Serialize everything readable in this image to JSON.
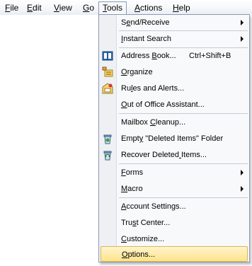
{
  "menubar": {
    "items": [
      {
        "label": "File",
        "accel": "F"
      },
      {
        "label": "Edit",
        "accel": "E"
      },
      {
        "label": "View",
        "accel": "V"
      },
      {
        "label": "Go",
        "accel": "G"
      },
      {
        "label": "Tools",
        "accel": "T",
        "active": true
      },
      {
        "label": "Actions",
        "accel": "A"
      },
      {
        "label": "Help",
        "accel": "H"
      }
    ]
  },
  "tools_menu": {
    "items": [
      {
        "label": "Send/Receive",
        "accel_index": 1,
        "submenu": true,
        "icon": null
      },
      {
        "label": "Instant Search",
        "accel_index": 0,
        "submenu": true,
        "icon": null
      },
      {
        "label": "Address Book...",
        "accel_index": 8,
        "shortcut": "Ctrl+Shift+B",
        "icon": "address-book-icon"
      },
      {
        "label": "Organize",
        "accel_index": 0,
        "icon": "organize-icon"
      },
      {
        "label": "Rules and Alerts...",
        "accel_index": 2,
        "icon": "rules-alerts-icon"
      },
      {
        "label": "Out of Office Assistant...",
        "accel_index": 0,
        "icon": null
      },
      {
        "label": "Mailbox Cleanup...",
        "accel_index": 8,
        "icon": null
      },
      {
        "label": "Empty \"Deleted Items\" Folder",
        "accel_index": 4,
        "icon": "empty-trash-icon"
      },
      {
        "label": "Recover Deleted Items...",
        "accel_index": 15,
        "icon": "recover-trash-icon"
      },
      {
        "label": "Forms",
        "accel_index": 0,
        "submenu": true,
        "icon": null
      },
      {
        "label": "Macro",
        "accel_index": 0,
        "submenu": true,
        "icon": null
      },
      {
        "label": "Account Settings...",
        "accel_index": 0,
        "icon": null
      },
      {
        "label": "Trust Center...",
        "accel_index": 3,
        "icon": null
      },
      {
        "label": "Customize...",
        "accel_index": 0,
        "icon": null
      },
      {
        "label": "Options...",
        "accel_index": 0,
        "icon": null,
        "highlighted": true
      }
    ]
  },
  "colors": {
    "highlight_top": "#fff4cc",
    "highlight_bottom": "#ffe38a",
    "highlight_border": "#d8b75a",
    "menu_border": "#8a9bb4",
    "icon_gutter": "#eef0f4"
  }
}
